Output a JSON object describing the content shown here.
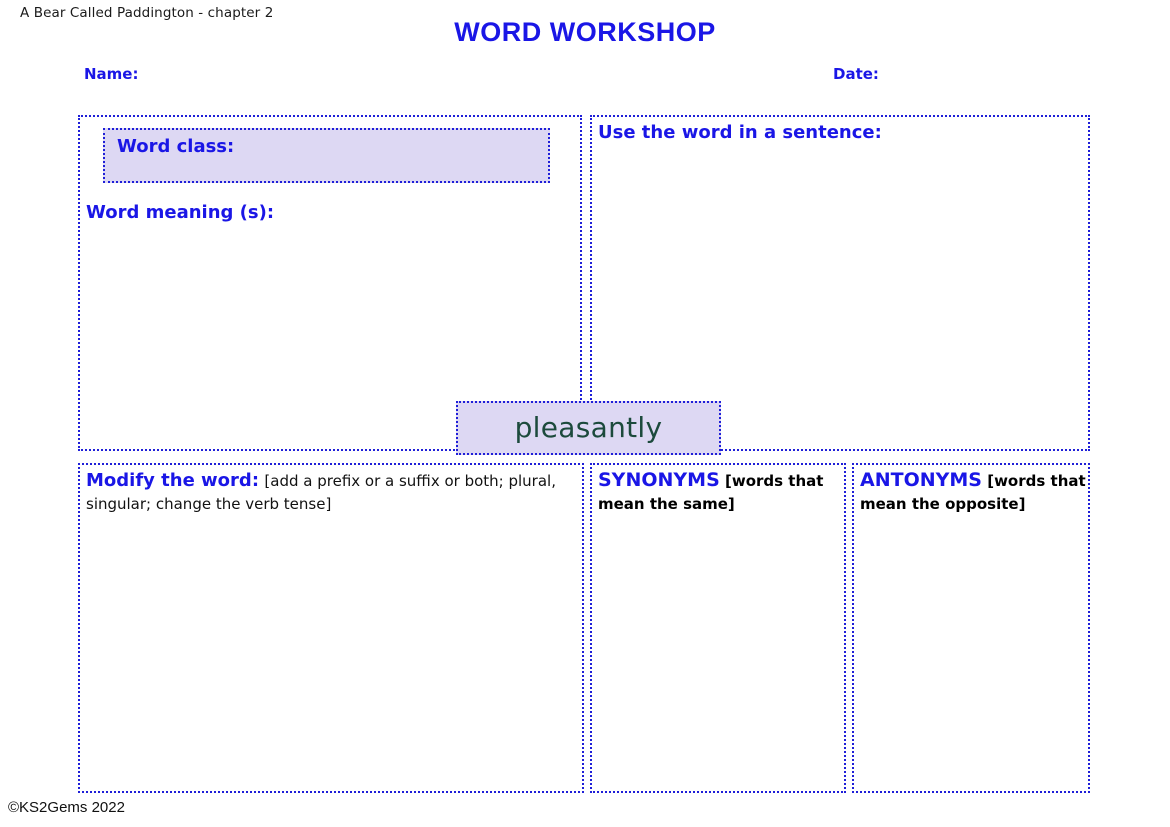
{
  "header": {
    "book_reference": "A Bear Called Paddington - chapter 2",
    "title": "WORD WORKSHOP",
    "name_label": "Name:",
    "date_label": "Date:"
  },
  "focus_word": {
    "text": "pleasantly",
    "fill_color": "#ddd8f3",
    "text_color": "#1c4a3c"
  },
  "panels": {
    "word_class": {
      "label": "Word class:",
      "value": "",
      "fill_color": "#ddd8f3"
    },
    "word_meaning": {
      "label": "Word meaning (s):",
      "value": ""
    },
    "sentence": {
      "label": "Use the word in a sentence:",
      "value": ""
    },
    "modify": {
      "label": "Modify the word:",
      "hint": "[add a prefix or a suffix or both; plural, singular; change the verb tense]",
      "value": ""
    },
    "synonyms": {
      "label": "SYNONYMS",
      "hint": "[words that mean the same]",
      "value": ""
    },
    "antonyms": {
      "label": "ANTONYMS",
      "hint": "[words that mean the opposite]",
      "value": ""
    }
  },
  "footer": {
    "credit": "©KS2Gems 2022"
  },
  "theme": {
    "accent_blue": "#1a16e6",
    "border_blue": "#1f1fd8",
    "box_fill": "#ddd8f3",
    "word_green": "#1c4a3c",
    "page_background": "#ffffff"
  }
}
